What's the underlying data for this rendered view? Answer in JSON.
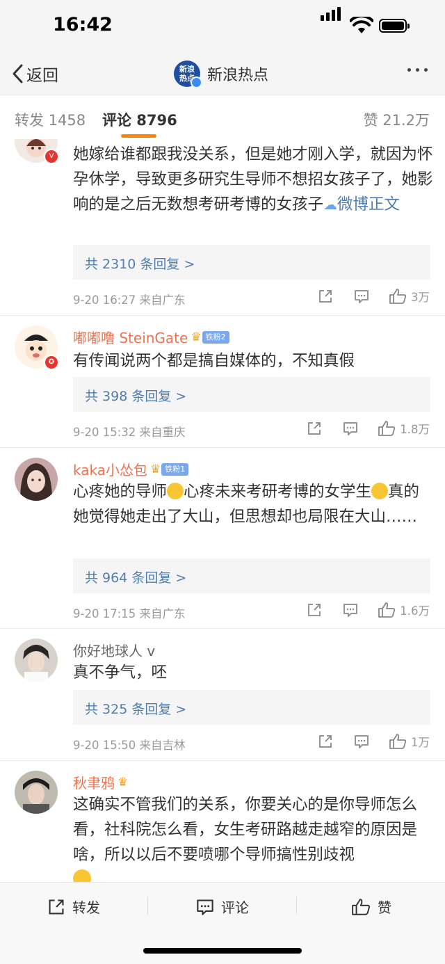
{
  "status_bar": {
    "time": "16:42"
  },
  "nav": {
    "back_label": "返回",
    "logo_text": "新浪热点",
    "title": "新浪热点"
  },
  "tabs": {
    "repost": "转发 1458",
    "comment": "评论 8796",
    "like": "赞 21.2万"
  },
  "comments": [
    {
      "text": "她嫁给谁都跟我没关系，但是她才刚入学，就因为怀孕休学，导致更多研究生导师不想招女孩子了，她影响的是之后无数想考研考博的女孩子",
      "link": "微博正文",
      "replies": "共 2310 条回复 >",
      "meta": "9-20 16:27 来自广东",
      "likes": "3万"
    },
    {
      "name": "嘟嘟噜 SteinGate",
      "fan_badge": "铁粉2",
      "text": "有传闻说两个都是搞自媒体的，不知真假",
      "replies": "共 398 条回复 >",
      "meta": "9-20 15:32 来自重庆",
      "likes": "1.8万"
    },
    {
      "name": "kaka小怂包",
      "fan_badge": "铁粉1",
      "text_a": "心疼她的导师",
      "text_b": "心疼未来考研考博的女学生",
      "text_c": "真的她觉得她走出了大山，但思想却也局限在大山……",
      "replies": "共 964 条回复 >",
      "meta": "9-20 17:15 来自广东",
      "likes": "1.6万"
    },
    {
      "name": "你好地球人 v",
      "text": "真不争气，呸",
      "replies": "共 325 条回复 >",
      "meta": "9-20 15:50 来自吉林",
      "likes": "1万"
    },
    {
      "name": "秋聿鸦",
      "text": "这确实不管我们的关系，你要关心的是你导师怎么看，社科院怎么看，女生考研路越走越窄的原因是啥，所以以后不要喷哪个导师搞性别歧视"
    }
  ],
  "toolbar": {
    "repost": "转发",
    "comment": "评论",
    "like": "赞"
  },
  "colors": {
    "accent": "#ff8200",
    "username": "#eb7350",
    "link": "#507daf"
  }
}
